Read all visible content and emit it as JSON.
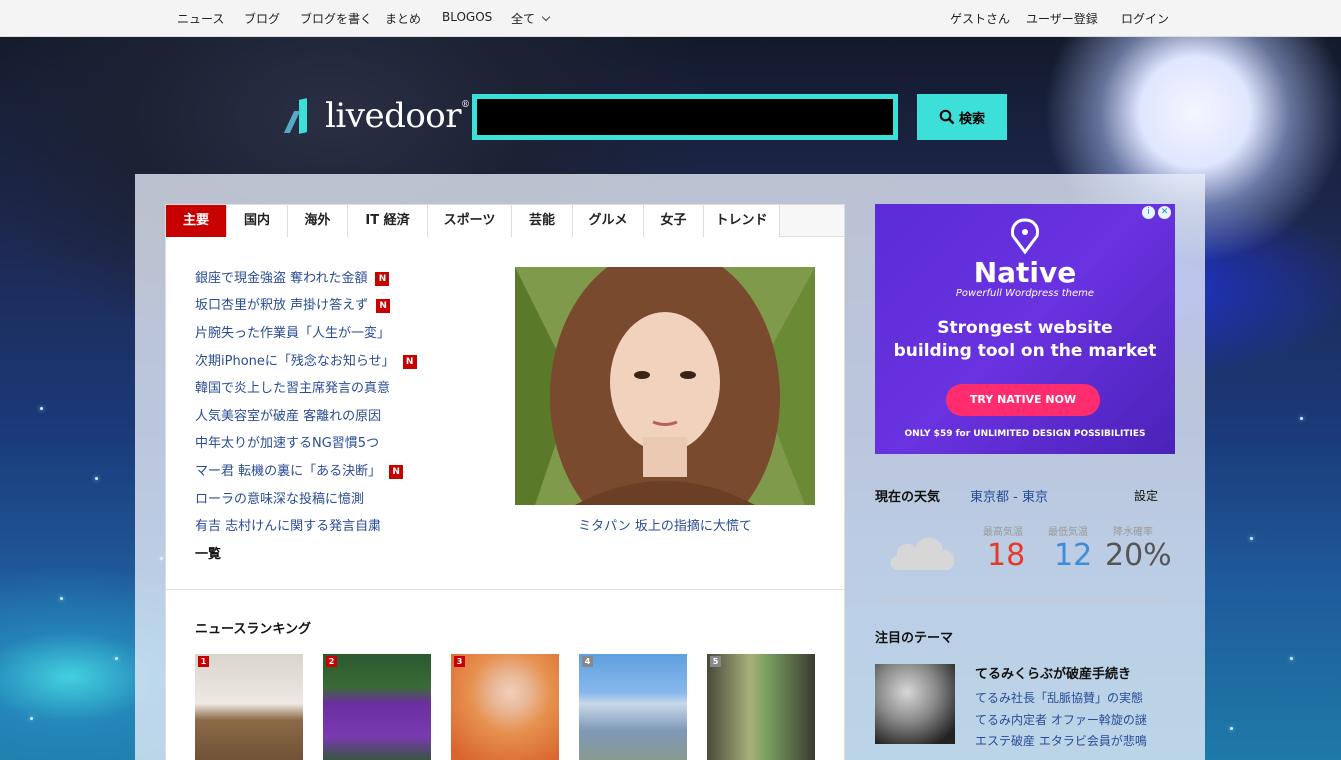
{
  "topnav": {
    "left": [
      "ニュース",
      "ブログ",
      "ブログを書く",
      "まとめ",
      "BLOGOS",
      "全て"
    ],
    "right": [
      "ゲストさん",
      "ユーザー登録",
      "ログイン"
    ]
  },
  "header": {
    "logo_text": "livedoor",
    "search_value": "",
    "search_button": "検索"
  },
  "tabs": [
    "主要",
    "国内",
    "海外",
    "IT 経済",
    "スポーツ",
    "芸能",
    "グルメ",
    "女子",
    "トレンド"
  ],
  "headlines": [
    {
      "text": "銀座で現金強盗 奪われた金額",
      "new": true
    },
    {
      "text": "坂口杏里が釈放 声掛け答えず",
      "new": true
    },
    {
      "text": "片腕失った作業員「人生が一変」",
      "new": false
    },
    {
      "text": "次期iPhoneに「残念なお知らせ」",
      "new": true
    },
    {
      "text": "韓国で炎上した習主席発言の真意",
      "new": false
    },
    {
      "text": "人気美容室が破産 客離れの原因",
      "new": false
    },
    {
      "text": "中年太りが加速するNG習慣5つ",
      "new": false
    },
    {
      "text": "マー君 転機の裏に「ある決断」",
      "new": true
    },
    {
      "text": "ローラの意味深な投稿に憶測",
      "new": false
    },
    {
      "text": "有吉 志村けんに関する発言自粛",
      "new": false
    }
  ],
  "new_badge": "N",
  "more_link": "一覧",
  "feature_caption": "ミタパン 坂上の指摘に大慌て",
  "ranking": {
    "title": "ニュースランキング",
    "items": [
      "1",
      "2",
      "3",
      "4",
      "5"
    ]
  },
  "ad": {
    "brand": "Native",
    "tagline": "Powerfull Wordpress theme",
    "headline1": "Strongest website",
    "headline2": "building tool on the market",
    "cta": "TRY NATIVE NOW",
    "footer": "ONLY $59 for UNLIMITED DESIGN POSSIBILITIES"
  },
  "weather": {
    "title": "現在の天気",
    "location": "東京都 - 東京",
    "settings": "設定",
    "high_label": "最高気温",
    "low_label": "最低気温",
    "rain_label": "降水確率",
    "high": "18",
    "low": "12",
    "rain": "20%",
    "colors": {
      "high": "#e53a2a",
      "low": "#3c8ddb",
      "rain": "#555555"
    }
  },
  "theme": {
    "title": "注目のテーマ",
    "headline": "てるみくらぶが破産手続き",
    "links": [
      "てるみ社長「乱脈協賛」の実態",
      "てるみ内定者 オファー斡旋の謎",
      "エステ破産 エタラビ会員が悲鳴"
    ]
  },
  "colors": {
    "accent": "#3ce0d8",
    "tab_active": "#c90000",
    "link": "#2a4c96"
  }
}
